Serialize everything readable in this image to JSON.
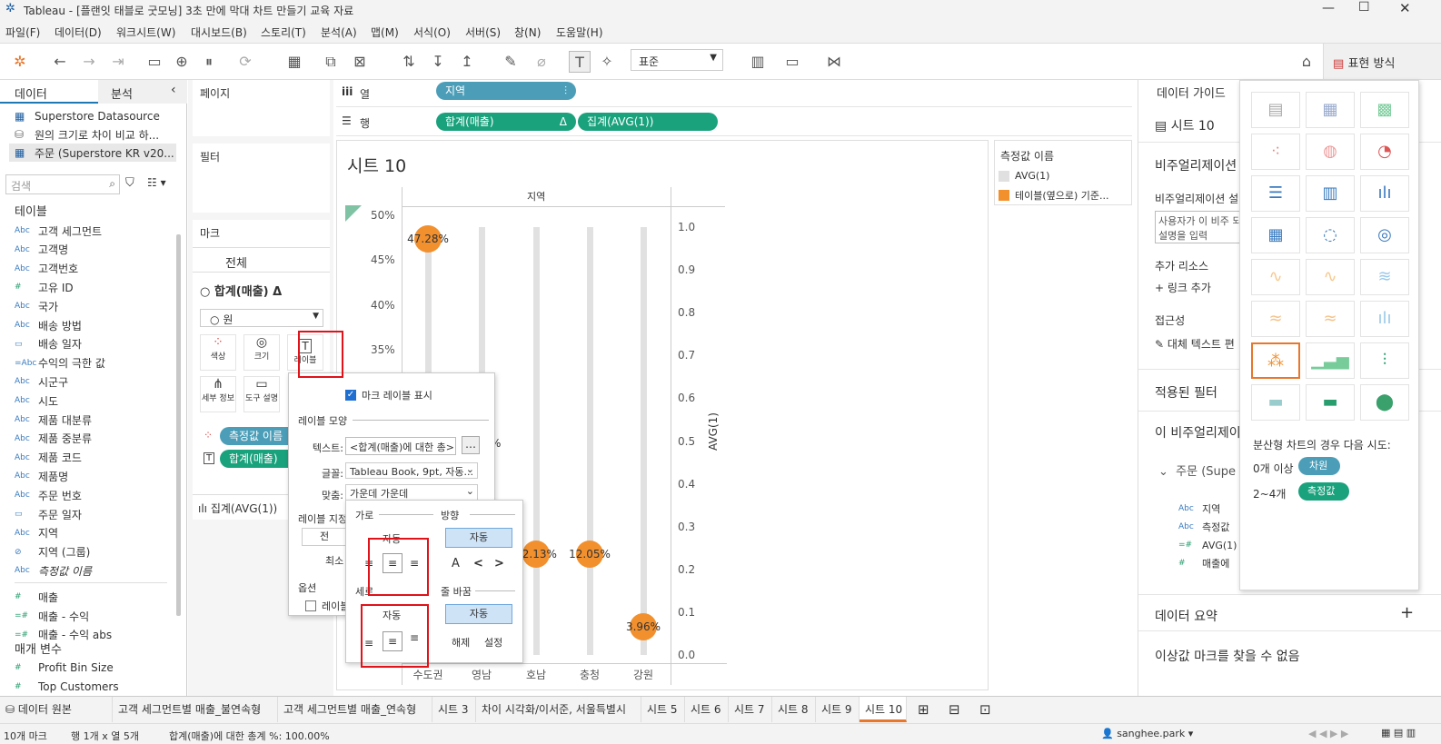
{
  "window": {
    "title": "Tableau - [플랜잇 태블로 굿모닝] 3초 만에 막대 차트 만들기 교육 자료"
  },
  "menu": [
    "파일(F)",
    "데이터(D)",
    "워크시트(W)",
    "대시보드(B)",
    "스토리(T)",
    "분석(A)",
    "맵(M)",
    "서식(O)",
    "서버(S)",
    "창(N)",
    "도움말(H)"
  ],
  "toolbar": {
    "fit_select": "표준",
    "show_me": "표현 방식"
  },
  "left": {
    "tab_data": "데이터",
    "tab_analysis": "분석",
    "sources": [
      "Superstore Datasource",
      "원의 크기로 차이 비교 하...",
      "주문 (Superstore KR v20..."
    ],
    "search_placeholder": "검색",
    "tables_label": "테이블",
    "fields": [
      {
        "type": "Abc",
        "name": "고객 세그먼트"
      },
      {
        "type": "Abc",
        "name": "고객명"
      },
      {
        "type": "Abc",
        "name": "고객번호"
      },
      {
        "type": "#",
        "name": "고유 ID"
      },
      {
        "type": "Abc",
        "name": "국가"
      },
      {
        "type": "Abc",
        "name": "배송 방법"
      },
      {
        "type": "cal",
        "name": "배송 일자"
      },
      {
        "type": "=Abc",
        "name": "수익의 극한 값"
      },
      {
        "type": "Abc",
        "name": "시군구"
      },
      {
        "type": "Abc",
        "name": "시도"
      },
      {
        "type": "Abc",
        "name": "제품 대분류"
      },
      {
        "type": "Abc",
        "name": "제품 중분류"
      },
      {
        "type": "Abc",
        "name": "제품 코드"
      },
      {
        "type": "Abc",
        "name": "제품명"
      },
      {
        "type": "Abc",
        "name": "주문 번호"
      },
      {
        "type": "cal",
        "name": "주문 일자"
      },
      {
        "type": "Abc",
        "name": "지역"
      },
      {
        "type": "clip",
        "name": "지역 (그룹)"
      },
      {
        "type": "Abc",
        "name": "측정값 이름"
      },
      {
        "type": "#",
        "name": "매출"
      },
      {
        "type": "=#",
        "name": "매출 - 수익"
      },
      {
        "type": "=#",
        "name": "매출 - 수익 abs"
      }
    ],
    "params_label": "매개 변수",
    "params": [
      "Profit Bin Size",
      "Top Customers"
    ]
  },
  "shelves": {
    "pages": "페이지",
    "filters": "필터",
    "marks": "마크",
    "marks_all": "전체",
    "marks_sum_sales": "합계(매출) Δ",
    "mark_type": "원",
    "mark_buttons": [
      "색상",
      "크기",
      "레이블",
      "세부 정보",
      "도구 설명"
    ],
    "mark_pills": [
      "측정값 이름",
      "합계(매출)"
    ],
    "marks_avg": "집계(AVG(1))",
    "columns_label": "열",
    "rows_label": "행",
    "column_pill": "지역",
    "row_pills": [
      "합계(매출)",
      "집계(AVG(1))"
    ]
  },
  "view": {
    "sheet_title": "시트 10",
    "x_header": "지역",
    "y_right_label": "AVG(1)",
    "legend_title": "측정값 이름",
    "legend_items": [
      {
        "label": "AVG(1)",
        "color": "#e0e0e0"
      },
      {
        "label": "테이블(옆으로) 기준...",
        "color": "#f2902e"
      }
    ]
  },
  "chart_data": {
    "type": "scatter",
    "categories": [
      "수도권",
      "영남",
      "호남",
      "충청",
      "강원"
    ],
    "values_visible_labels": [
      "47.28%",
      "",
      "12.13%",
      "12.05%",
      "3.96%"
    ],
    "values": [
      47.28,
      null,
      12.13,
      12.05,
      3.96
    ],
    "y_left_ticks": [
      "50%",
      "45%",
      "40%",
      "35%"
    ],
    "y_right_ticks": [
      "1.0",
      "0.9",
      "0.8",
      "0.7",
      "0.6",
      "0.5",
      "0.4",
      "0.3",
      "0.2",
      "0.1",
      "0.0"
    ],
    "xlabel": "지역",
    "ylabel_right": "AVG(1)"
  },
  "label_popup": {
    "show_labels": "마크 레이블 표시",
    "appearance": "레이블 모양",
    "text_label": "텍스트:",
    "text_value": "<합계(매출)에 대한 총>",
    "font_label": "글꼴:",
    "font_value": "Tableau Book, 9pt, 자동...",
    "align_label": "맞춤:",
    "align_value": "가운데 가운데",
    "label_marks": "레이블 지정",
    "all_btn": "전",
    "min_label": "최소",
    "options": "옵션",
    "opt_check": "레이블"
  },
  "align_popup": {
    "horizontal": "가로",
    "direction": "방향",
    "auto": "자동",
    "vertical": "세로",
    "wrap": "줄 바꿈",
    "off": "해제",
    "on": "설정",
    "dir_auto": "자동",
    "dir_glyphs": [
      "A",
      "<",
      "<"
    ]
  },
  "data_guide": {
    "title": "데이터 가이드",
    "sheet": "시트 10",
    "viz_heading": "비주얼리제이션",
    "viz_desc_label": "비주얼리제이션 설",
    "viz_desc_placeholder": "사용자가 이 비주 되는 설명을 입력",
    "resources": "추가 리소스",
    "add_link": "링크 추가",
    "access": "접근성",
    "alt_text": "대체 텍스트 편",
    "applied_filters": "적용된 필터",
    "this_viz": "이 비주얼리제이",
    "source_item": "주문 (Supe",
    "fields": [
      "지역",
      "측정값",
      "AVG(1)",
      "매출에"
    ],
    "data_summary": "데이터 요약",
    "outliers": "이상값 마크를 찾을 수 없음"
  },
  "show_me": {
    "hint": "분산형 차트의 경우 다음 시도:",
    "row1_label": "0개 이상",
    "row1_pill": "차원",
    "row2_label": "2~4개",
    "row2_pill": "측정값"
  },
  "tabs": {
    "datasource": "데이터 원본",
    "sheets": [
      "고객 세그먼트별 매출_불연속형",
      "고객 세그먼트별 매출_연속형",
      "시트 3",
      "차이 시각화/이서준, 서울특별시",
      "시트 5",
      "시트 6",
      "시트 7",
      "시트 8",
      "시트 9",
      "시트 10"
    ]
  },
  "status": {
    "marks": "10개 마크",
    "rows_cols": "행 1개 x 열 5개",
    "sum": "합계(매출)에 대한 총계 %: 100.00%",
    "user": "sanghee.park"
  }
}
